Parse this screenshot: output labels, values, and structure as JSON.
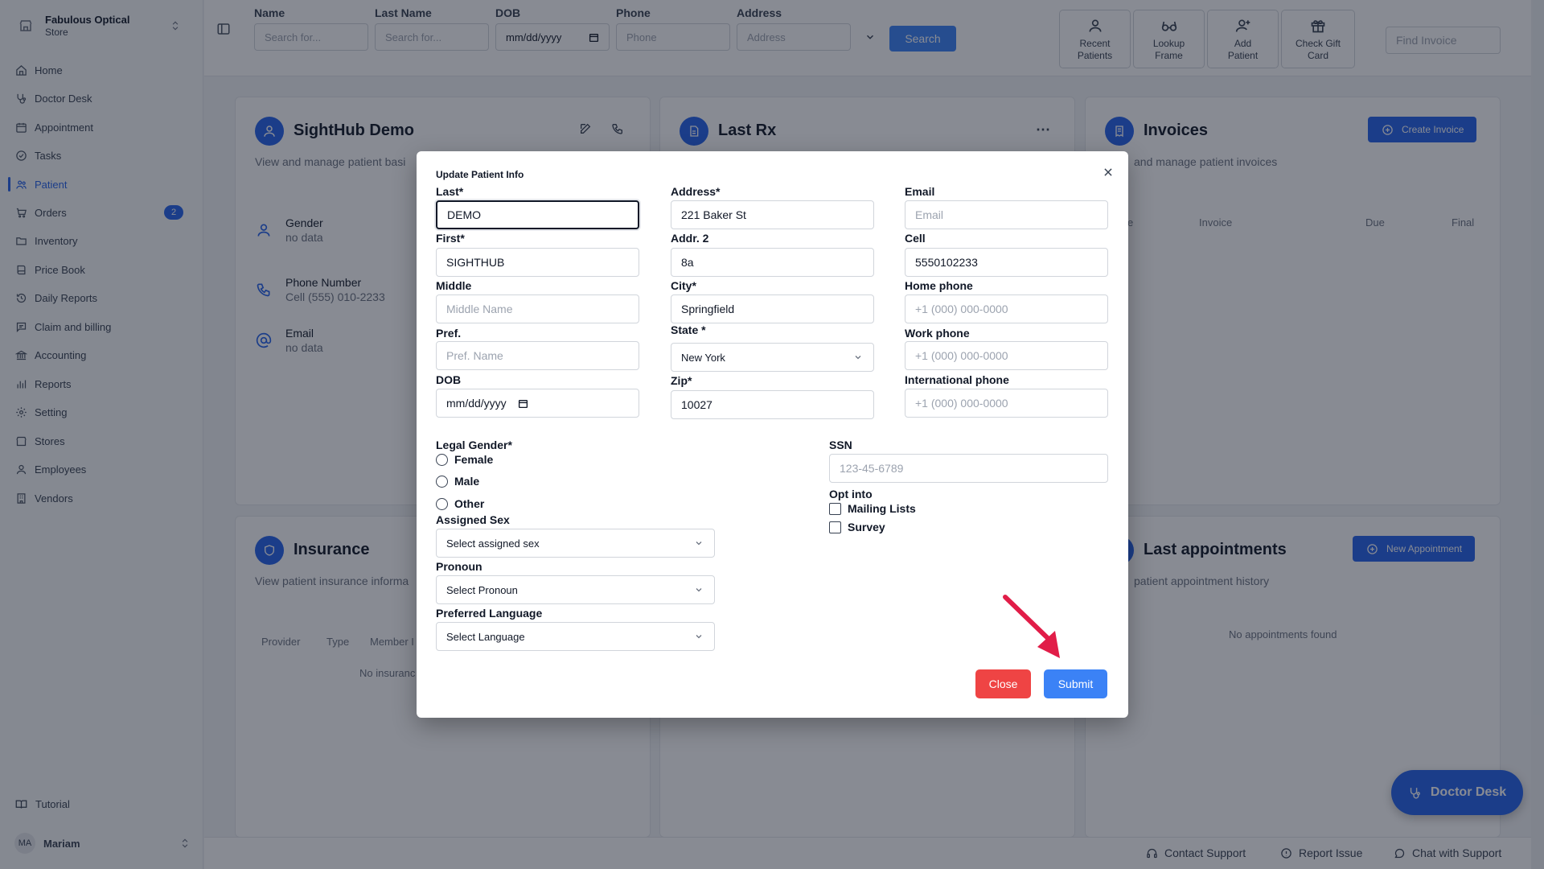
{
  "sidebar": {
    "store_name": "Fabulous Optical",
    "store_sub": "Store",
    "items": [
      {
        "label": "Home",
        "icon": "home-icon"
      },
      {
        "label": "Doctor Desk",
        "icon": "stethoscope-icon"
      },
      {
        "label": "Appointment",
        "icon": "calendar-icon"
      },
      {
        "label": "Tasks",
        "icon": "check-circle-icon"
      },
      {
        "label": "Patient",
        "icon": "users-icon"
      },
      {
        "label": "Orders",
        "icon": "cart-icon",
        "badge": "2"
      },
      {
        "label": "Inventory",
        "icon": "folder-icon"
      },
      {
        "label": "Price Book",
        "icon": "book-icon"
      },
      {
        "label": "Daily Reports",
        "icon": "history-icon"
      },
      {
        "label": "Claim and billing",
        "icon": "message-icon"
      },
      {
        "label": "Accounting",
        "icon": "bank-icon"
      },
      {
        "label": "Reports",
        "icon": "bar-chart-icon"
      },
      {
        "label": "Setting",
        "icon": "gear-icon"
      },
      {
        "label": "Stores",
        "icon": "store-icon"
      },
      {
        "label": "Employees",
        "icon": "user-icon"
      },
      {
        "label": "Vendors",
        "icon": "building-icon"
      }
    ],
    "tutorial_label": "Tutorial",
    "user_initials": "MA",
    "user_name": "Mariam"
  },
  "search": {
    "name_label": "Name",
    "name_placeholder": "Search for...",
    "lastname_label": "Last Name",
    "lastname_placeholder": "Search for...",
    "dob_label": "DOB",
    "dob_value": "mm/dd/yyyy",
    "phone_label": "Phone",
    "phone_placeholder": "Phone",
    "address_label": "Address",
    "address_placeholder": "Address",
    "search_button": "Search"
  },
  "toolbar": {
    "recent_line1": "Recent",
    "recent_line2": "Patients",
    "lookup_line1": "Lookup",
    "lookup_line2": "Frame",
    "add_line1": "Add",
    "add_line2": "Patient",
    "gift_line1": "Check Gift",
    "gift_line2": "Card",
    "find_invoice_placeholder": "Find Invoice"
  },
  "patient_card": {
    "title": "SightHub Demo",
    "subtitle": "View and manage patient basi",
    "gender_label": "Gender",
    "gender_value": "no data",
    "phone_label": "Phone Number",
    "phone_value": "Cell (555) 010-2233",
    "email_label": "Email",
    "email_value": "no data"
  },
  "rx_card": {
    "title": "Last Rx"
  },
  "invoices_card": {
    "title": "Invoices",
    "subtitle": "and manage patient invoices",
    "create_button": "Create Invoice",
    "col_e": "e",
    "col_invoice": "Invoice",
    "col_due": "Due",
    "col_final": "Final"
  },
  "insurance_card": {
    "title": "Insurance",
    "subtitle": "View patient insurance informa",
    "col_provider": "Provider",
    "col_type": "Type",
    "col_member": "Member I",
    "empty": "No insuranc"
  },
  "appointments_card": {
    "title": "Last appointments",
    "subtitle": "patient appointment history",
    "new_button": "New Appointment",
    "empty": "No appointments found"
  },
  "footer": {
    "contact": "Contact Support",
    "report": "Report Issue",
    "chat": "Chat with Support"
  },
  "fab_label": "Doctor Desk",
  "modal": {
    "title": "Update Patient Info",
    "last_label": "Last*",
    "last_value": "DEMO",
    "first_label": "First*",
    "first_value": "SIGHTHUB",
    "middle_label": "Middle",
    "middle_placeholder": "Middle Name",
    "pref_label": "Pref.",
    "pref_placeholder": "Pref. Name",
    "dob_label": "DOB",
    "dob_value": "mm/dd/yyyy",
    "address_label": "Address*",
    "address_value": "221 Baker St",
    "addr2_label": "Addr. 2",
    "addr2_value": "8a",
    "city_label": "City*",
    "city_value": "Springfield",
    "state_label": "State *",
    "state_value": "New York",
    "zip_label": "Zip*",
    "zip_value": "10027",
    "email_label": "Email",
    "email_placeholder": "Email",
    "cell_label": "Cell",
    "cell_value": "5550102233",
    "home_label": "Home phone",
    "home_placeholder": "+1 (000) 000-0000",
    "work_label": "Work phone",
    "work_placeholder": "+1 (000) 000-0000",
    "intl_label": "International phone",
    "intl_placeholder": "+1 (000) 000-0000",
    "gender_label": "Legal Gender*",
    "gender_options": [
      "Female",
      "Male",
      "Other"
    ],
    "sex_label": "Assigned Sex",
    "sex_placeholder": "Select assigned sex",
    "pronoun_label": "Pronoun",
    "pronoun_placeholder": "Select Pronoun",
    "language_label": "Preferred Language",
    "language_placeholder": "Select Language",
    "ssn_label": "SSN",
    "ssn_placeholder": "123-45-6789",
    "opt_label": "Opt into",
    "opt_options": [
      "Mailing Lists",
      "Survey"
    ],
    "close_button": "Close",
    "submit_button": "Submit"
  },
  "colors": {
    "primary": "#2563eb",
    "submit": "#3b82f6",
    "close": "#ef4444",
    "annotation_arrow": "#e11d48",
    "overlay": "rgba(17,24,39,0.5)"
  }
}
